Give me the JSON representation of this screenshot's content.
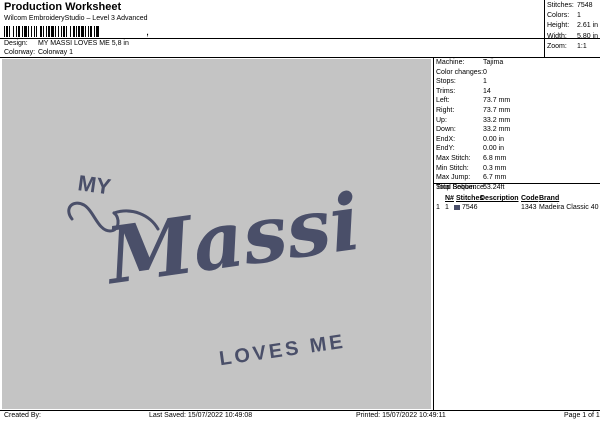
{
  "header": {
    "title": "Production Worksheet",
    "subtitle": "Wilcom EmbroideryStudio – Level 3 Advanced",
    "barcode_suffix": ","
  },
  "design": {
    "label": "Design:",
    "value": "MY MASSI LOVES ME 5,8 in"
  },
  "colorway": {
    "label": "Colorway:",
    "value": "Colorway 1"
  },
  "stats": [
    {
      "label": "Stitches:",
      "value": "7548"
    },
    {
      "label": "Colors:",
      "value": "1"
    },
    {
      "label": "Height:",
      "value": "2.61 in"
    },
    {
      "label": "Width:",
      "value": "5.80 in"
    },
    {
      "label": "Zoom:",
      "value": "1:1"
    }
  ],
  "preview": {
    "text_line1": "MY",
    "text_line2": "Massi",
    "text_line3": "LOVES ME",
    "thread_color": "#4a4f69",
    "background_color": "#c4c4c4"
  },
  "properties": [
    {
      "label": "Machine:",
      "value": "Tajima"
    },
    {
      "label": "Color changes:",
      "value": "0"
    },
    {
      "label": "Stops:",
      "value": "1"
    },
    {
      "label": "Trims:",
      "value": "14"
    },
    {
      "label": "Left:",
      "value": "73.7 mm"
    },
    {
      "label": "Right:",
      "value": "73.7 mm"
    },
    {
      "label": "Up:",
      "value": "33.2 mm"
    },
    {
      "label": "Down:",
      "value": "33.2 mm"
    },
    {
      "label": "EndX:",
      "value": "0.00 in"
    },
    {
      "label": "EndY:",
      "value": "0.00 in"
    },
    {
      "label": "Max Stitch:",
      "value": "6.8 mm"
    },
    {
      "label": "Min Stitch:",
      "value": "0.3 mm"
    },
    {
      "label": "Max Jump:",
      "value": "6.7 mm"
    },
    {
      "label": "Total Bobbin:",
      "value": "53.24ft"
    }
  ],
  "stop_sequence": {
    "title": "Stop Sequence:",
    "headers": {
      "index": "",
      "number": "N#",
      "stitches": "Stitches",
      "description": "Description",
      "code": "Code",
      "brand": "Brand"
    },
    "rows": [
      {
        "index": "1",
        "number": "1",
        "stitches": "7546",
        "description": "",
        "code": "1343",
        "brand": "Madeira Classic 40"
      }
    ]
  },
  "footer": {
    "created_by": "Created By:",
    "last_saved": "Last Saved: 15/07/2022 10:49:08",
    "printed": "Printed: 15/07/2022 10:49:11",
    "page": "Page 1 of 1"
  }
}
